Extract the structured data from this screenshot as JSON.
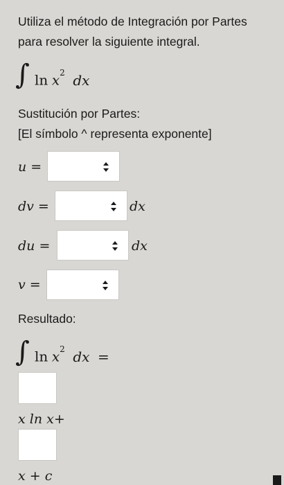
{
  "instructions": {
    "line1": "Utiliza el método de Integración por Partes",
    "line2": "para resolver la siguiente integral."
  },
  "integral": {
    "sign": "∫",
    "integrand_fn": "ln",
    "integrand_var": "x",
    "exponent": "2",
    "differential": "dx"
  },
  "substitution": {
    "heading": "Sustitución por Partes:",
    "note": "[El símbolo ^ representa exponente]",
    "rows": [
      {
        "label": "u =",
        "suffix": ""
      },
      {
        "label": "dv =",
        "suffix": "dx"
      },
      {
        "label": "du =",
        "suffix": "dx"
      },
      {
        "label": "v =",
        "suffix": ""
      }
    ]
  },
  "result": {
    "heading": "Resultado:",
    "equals": "=",
    "term1": "x ln x+",
    "term2": "x + c"
  },
  "icons": {
    "select_arrows": "updown-chevron-icon"
  }
}
